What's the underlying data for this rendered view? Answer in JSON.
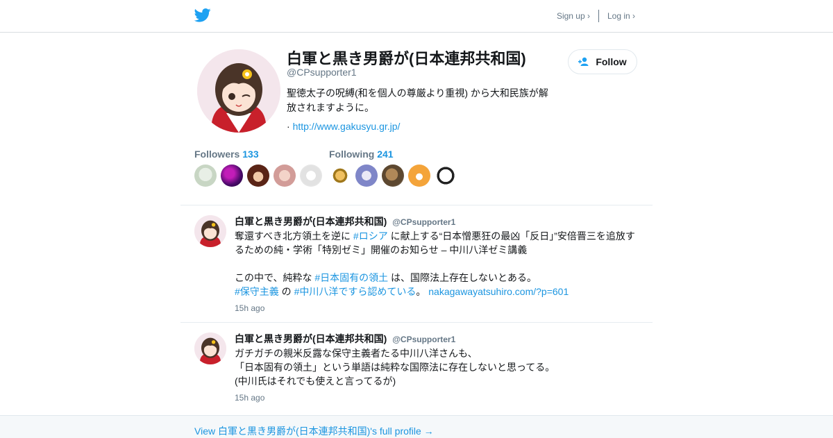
{
  "brand": {
    "logo_icon": "twitter-bird-icon",
    "color": "#1da1f2"
  },
  "nav": {
    "signup": "Sign up ›",
    "login": "Log in ›"
  },
  "profile": {
    "name": "白軍と黒き男爵が(日本連邦共和国)",
    "handle": "@CPsupporter1",
    "bio": "聖徳太子の呪縛(和を個人の尊厳より重視) から大和民族が解放されますように。",
    "url_prefix": "·",
    "url": "http://www.gakusyu.gr.jp/",
    "follow_label": "Follow"
  },
  "followers": {
    "label": "Followers",
    "count": "133"
  },
  "following": {
    "label": "Following",
    "count": "241"
  },
  "tweets": [
    {
      "name": "白軍と黒き男爵が(日本連邦共和国)",
      "handle": "@CPsupporter1",
      "line1_a": "奪還すべき北方領土を逆に ",
      "tag1": "#ロシア",
      "line1_b": " に献上する“日本憎悪狂の最凶「反日」”安倍晋三を追放するための純・学術「特別ゼミ」開催のお知らせ – 中川八洋ゼミ講義",
      "line2_a": "この中で、純粋な ",
      "tag2": "#日本固有の領土",
      "line2_b": " は、国際法上存在しないとある。",
      "tag3": "#保守主義",
      "line3_a": " の ",
      "tag4": "#中川八洋ですら認めている",
      "line3_b": "。 ",
      "link": "nakagawayatsuhiro.com/?p=601",
      "time": "15h ago"
    },
    {
      "name": "白軍と黒き男爵が(日本連邦共和国)",
      "handle": "@CPsupporter1",
      "text": "ガチガチの親米反露な保守主義者たる中川八洋さんも、\n「日本固有の領土」という単語は純粋な国際法に存在しないと思ってる。\n(中川氏はそれでも使えと言ってるが)",
      "time": "15h ago"
    }
  ],
  "footer": {
    "link": "View 白軍と黒き男爵が(日本連邦共和国)'s full profile →"
  }
}
